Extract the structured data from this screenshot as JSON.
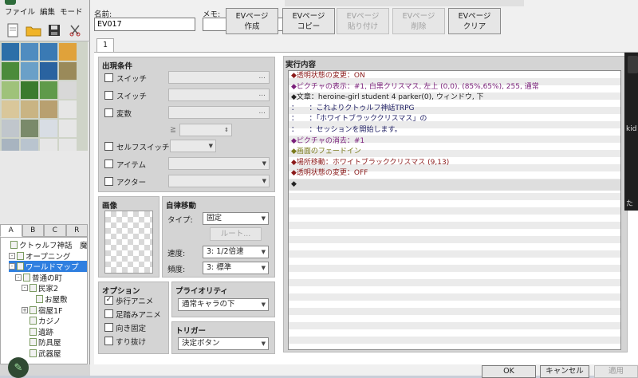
{
  "menu": {
    "items": [
      "ファイル",
      "編集",
      "モード"
    ]
  },
  "toolbar": {
    "icons": [
      "new-file-icon",
      "open-folder-icon",
      "save-icon",
      "cut-icon"
    ]
  },
  "tile_tabs": [
    "A",
    "B",
    "C",
    "R"
  ],
  "map_tree": [
    {
      "label": "クトゥルフ神話　魔",
      "indent": 0,
      "expander": "",
      "selected": false
    },
    {
      "label": "オープニング",
      "indent": 1,
      "expander": "-",
      "selected": false
    },
    {
      "label": "ワールドマップ",
      "indent": 1,
      "expander": "-",
      "selected": true
    },
    {
      "label": "普通の町",
      "indent": 2,
      "expander": "-",
      "selected": false
    },
    {
      "label": "民家2",
      "indent": 3,
      "expander": "-",
      "selected": false
    },
    {
      "label": "お屋敷",
      "indent": 4,
      "expander": "",
      "selected": false
    },
    {
      "label": "宿屋1F",
      "indent": 3,
      "expander": "+",
      "selected": false
    },
    {
      "label": "カジノ",
      "indent": 3,
      "expander": "",
      "selected": false
    },
    {
      "label": "遺跡",
      "indent": 3,
      "expander": "",
      "selected": false
    },
    {
      "label": "防具屋",
      "indent": 3,
      "expander": "",
      "selected": false
    },
    {
      "label": "武器屋",
      "indent": 3,
      "expander": "",
      "selected": false
    }
  ],
  "event": {
    "name_label": "名前:",
    "name_value": "EV017",
    "memo_label": "メモ:",
    "memo_value": ""
  },
  "page_buttons": [
    {
      "line1": "EVページ",
      "line2": "作成",
      "enabled": true
    },
    {
      "line1": "EVページ",
      "line2": "コピー",
      "enabled": true
    },
    {
      "line1": "EVページ",
      "line2": "貼り付け",
      "enabled": false
    },
    {
      "line1": "EVページ",
      "line2": "削除",
      "enabled": false
    },
    {
      "line1": "EVページ",
      "line2": "クリア",
      "enabled": true
    }
  ],
  "page_tab": "1",
  "conditions": {
    "title": "出現条件",
    "switch1_label": "スイッチ",
    "switch2_label": "スイッチ",
    "variable_label": "変数",
    "gte_symbol": "≧",
    "self_switch_label": "セルフスイッチ",
    "item_label": "アイテム",
    "actor_label": "アクター",
    "dots": "..."
  },
  "image": {
    "title": "画像"
  },
  "autonomous": {
    "title": "自律移動",
    "type_label": "タイプ:",
    "type_value": "固定",
    "route_button": "ルート...",
    "speed_label": "速度:",
    "speed_value": "3: 1/2倍速",
    "freq_label": "頻度:",
    "freq_value": "3: 標準"
  },
  "options": {
    "title": "オプション",
    "items": [
      {
        "label": "歩行アニメ",
        "checked": true
      },
      {
        "label": "足踏みアニメ",
        "checked": false
      },
      {
        "label": "向き固定",
        "checked": false
      },
      {
        "label": "すり抜け",
        "checked": false
      }
    ]
  },
  "priority": {
    "title": "プライオリティ",
    "value": "通常キャラの下"
  },
  "trigger": {
    "title": "トリガー",
    "value": "決定ボタン"
  },
  "exec": {
    "title": "実行内容",
    "rows": [
      {
        "text": "◆透明状態の変更：ON",
        "color": "#8b1a1a"
      },
      {
        "text": "◆ピクチャの表示：#1, 白黒クリスマス, 左上 (0,0), (85%,65%), 255, 通常",
        "color": "#7a1f7a"
      },
      {
        "text": "◆文章：heroine-girl student 4 parker(0), ウィンドウ, 下",
        "color": "#222222",
        "mixed": true
      },
      {
        "text": "：　　：これよりクトゥルフ神話TRPG",
        "color": "#222266"
      },
      {
        "text": "：　　：「ホワイトブラッククリスマス」の",
        "color": "#222266"
      },
      {
        "text": "：　　：セッションを開始します。",
        "color": "#222266"
      },
      {
        "text": "◆ピクチャの消去：#1",
        "color": "#7a1f7a"
      },
      {
        "text": "◆画面のフェードイン",
        "color": "#7a7a1a"
      },
      {
        "text": "◆場所移動：ホワイトブラッククリスマス (9,13)",
        "color": "#8b1a1a"
      },
      {
        "text": "◆透明状態の変更：OFF",
        "color": "#8b1a1a"
      },
      {
        "text": "◆",
        "color": "#222222"
      }
    ]
  },
  "overlay": {
    "text1": "kid",
    "text2": "た"
  },
  "footer": {
    "ok": "OK",
    "cancel": "キャンセル",
    "apply": "適用"
  },
  "colors": {
    "selection": "#2f7fe0",
    "panel": "#d4d4d4"
  }
}
